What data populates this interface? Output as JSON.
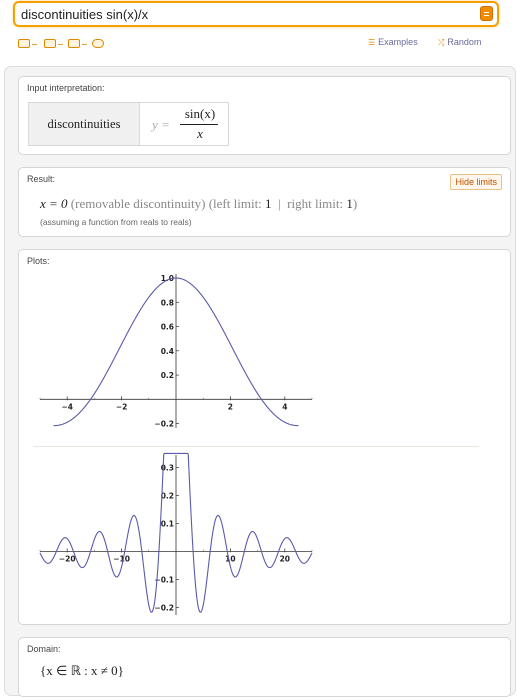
{
  "search": {
    "value": "discontinuities sin(x)/x",
    "go_icon": "equals-button-icon"
  },
  "toolbar": {
    "icons": [
      "keyboard-icon",
      "camera-icon",
      "upload-image-icon",
      "random-gear-icon"
    ]
  },
  "links": {
    "examples": "Examples",
    "random": "Random"
  },
  "input_interpretation": {
    "title": "Input interpretation:",
    "word": "discontinuities",
    "lhs": "y =",
    "numerator": "sin(x)",
    "denominator": "x"
  },
  "result": {
    "title": "Result:",
    "hide_button": "Hide limits",
    "lhs": "x = 0",
    "kind": "(removable discontinuity)",
    "left_label": "(left limit:",
    "left_value": "1",
    "separator": "|",
    "right_label": "right limit:",
    "right_value": "1",
    "close": ")",
    "note": "(assuming a function from reals to reals)"
  },
  "plots": {
    "title": "Plots:"
  },
  "domain": {
    "title": "Domain:",
    "value": "{x ∈ ℝ : x ≠ 0}"
  },
  "colors": {
    "curve": "#5a5aaa",
    "accent": "#f5a000",
    "link": "#6a6a9a"
  },
  "chart_data": [
    {
      "type": "line",
      "function": "sin(x)/x",
      "x": [
        -4.5,
        -4,
        -3.5,
        -3,
        -2.5,
        -2,
        -1.5,
        -1,
        -0.5,
        0,
        0.5,
        1,
        1.5,
        2,
        2.5,
        3,
        3.5,
        4,
        4.5
      ],
      "y": [
        -0.217,
        -0.189,
        -0.1,
        0.047,
        0.239,
        0.455,
        0.665,
        0.841,
        0.959,
        1.0,
        0.959,
        0.841,
        0.665,
        0.455,
        0.239,
        0.047,
        -0.1,
        -0.189,
        -0.217
      ],
      "xlim": [
        -5,
        5
      ],
      "ylim": [
        -0.22,
        1.0
      ],
      "xticks": [
        "-4",
        "-2",
        "2",
        "4"
      ],
      "yticks": [
        "1.0",
        "0.8",
        "0.6",
        "0.4",
        "0.2",
        "-0.2"
      ],
      "grid": false
    },
    {
      "type": "line",
      "function": "sin(x)/x",
      "x": [
        -25,
        -22.5,
        -20,
        -17.5,
        -15,
        -12.5,
        -10,
        -7.5,
        -5,
        -4.5,
        -2.5,
        2.5,
        4.5,
        5,
        7.5,
        10,
        12.5,
        15,
        17.5,
        20,
        22.5,
        25
      ],
      "y": [
        -0.005,
        -0.021,
        0.046,
        -0.056,
        0.043,
        -0.005,
        -0.054,
        0.125,
        -0.192,
        -0.217,
        0.239,
        0.239,
        -0.217,
        -0.192,
        0.125,
        -0.054,
        -0.005,
        0.043,
        -0.056,
        0.046,
        -0.021,
        -0.005
      ],
      "xlim": [
        -25,
        25
      ],
      "ylim": [
        -0.22,
        0.33
      ],
      "xticks": [
        "-20",
        "-10",
        "10",
        "20"
      ],
      "yticks": [
        "0.3",
        "0.2",
        "0.1",
        "-0.1",
        "-0.2"
      ],
      "grid": false
    }
  ]
}
